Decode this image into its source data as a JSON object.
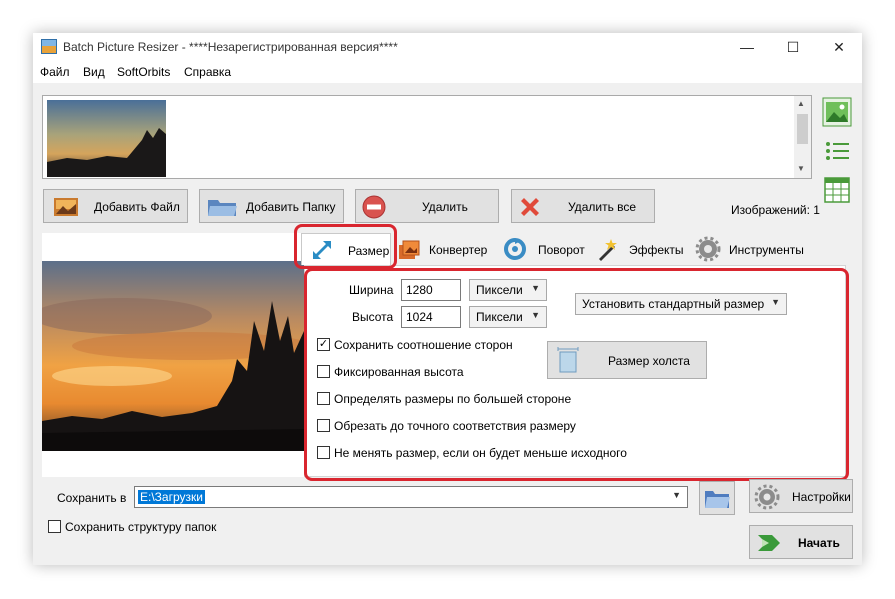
{
  "window": {
    "title": "Batch Picture Resizer - ****Незарегистрированная версия****",
    "controls": {
      "minimize": "—",
      "maximize": "☐",
      "close": "✕"
    }
  },
  "menu": [
    "Файл",
    "Вид",
    "SoftOrbits",
    "Справка"
  ],
  "toolbar": {
    "add_file": "Добавить Файл",
    "add_folder": "Добавить Папку",
    "delete": "Удалить",
    "delete_all": "Удалить все"
  },
  "image_count": "Изображений: 1",
  "tabs": [
    "Размер",
    "Конвертер",
    "Поворот",
    "Эффекты",
    "Инструменты"
  ],
  "active_tab": "Размер",
  "resize": {
    "width_label": "Ширина",
    "width_value": "1280",
    "width_unit": "Пиксели",
    "height_label": "Высота",
    "height_value": "1024",
    "height_unit": "Пиксели",
    "preset": "Установить стандартный размер",
    "canvas_button": "Размер холста",
    "options": [
      {
        "label": "Сохранить соотношение сторон",
        "checked": true
      },
      {
        "label": "Фиксированная высота",
        "checked": false
      },
      {
        "label": "Определять размеры по большей стороне",
        "checked": false
      },
      {
        "label": "Обрезать до точного соответствия размеру",
        "checked": false
      },
      {
        "label": "Не менять размер, если он будет меньше исходного",
        "checked": false
      }
    ]
  },
  "output": {
    "save_label": "Сохранить в",
    "save_path": "E:\\Загрузки",
    "keep_structure": "Сохранить структуру папок",
    "keep_structure_checked": false,
    "settings_button": "Настройки",
    "start_button": "Начать"
  },
  "colors": {
    "highlight_frame": "#d9262f",
    "selection": "#0078d7",
    "window_bg": "#f0f0f0"
  },
  "icons": [
    "app-icon",
    "image-view-icon",
    "list-view-icon",
    "grid-view-icon",
    "add-file-icon",
    "add-folder-icon",
    "delete-icon",
    "delete-all-icon",
    "resize-icon",
    "convert-icon",
    "rotate-icon",
    "effects-icon",
    "tools-icon",
    "canvas-icon",
    "browse-folder-icon",
    "gear-icon",
    "start-arrow-icon"
  ]
}
